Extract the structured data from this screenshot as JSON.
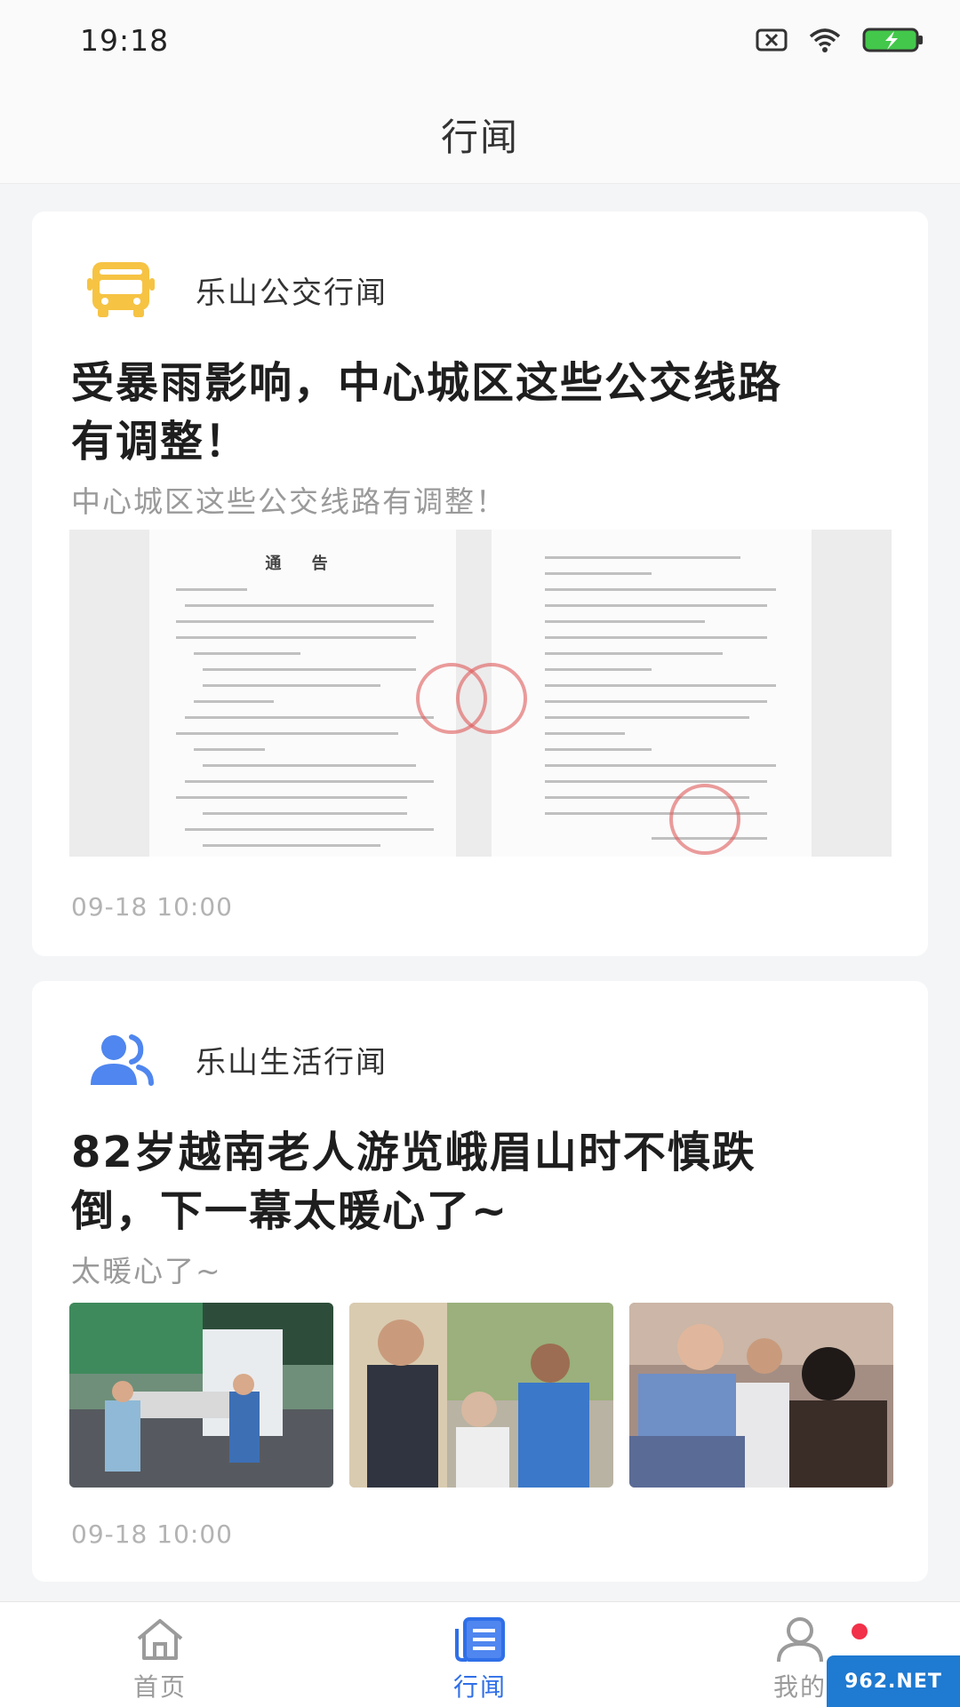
{
  "status_bar": {
    "time": "19:18"
  },
  "nav": {
    "title": "行闻"
  },
  "feed": [
    {
      "source": "乐山公交行闻",
      "headline_line1": "受暴雨影响，中心城区这些公交线路",
      "headline_line2": "有调整！",
      "summary": "中心城区这些公交线路有调整！",
      "document_title": "通 告",
      "timestamp": "09-18 10:00"
    },
    {
      "source": "乐山生活行闻",
      "headline_line1": "82岁越南老人游览峨眉山时不慎跌",
      "headline_line2": "倒，下一幕太暖心了~",
      "summary": "太暖心了~",
      "timestamp": "09-18 10:00"
    }
  ],
  "tabbar": {
    "items": [
      {
        "label": "首页",
        "icon": "home-icon",
        "active": false
      },
      {
        "label": "行闻",
        "icon": "news-icon",
        "active": true
      },
      {
        "label": "我的",
        "icon": "user-icon",
        "active": false
      }
    ]
  },
  "watermark": {
    "text": "962.NET"
  },
  "colors": {
    "accent": "#2f6fe8",
    "bus_icon": "#f6c343",
    "users_icon": "#4f86ef",
    "badge": "#f2314a"
  }
}
